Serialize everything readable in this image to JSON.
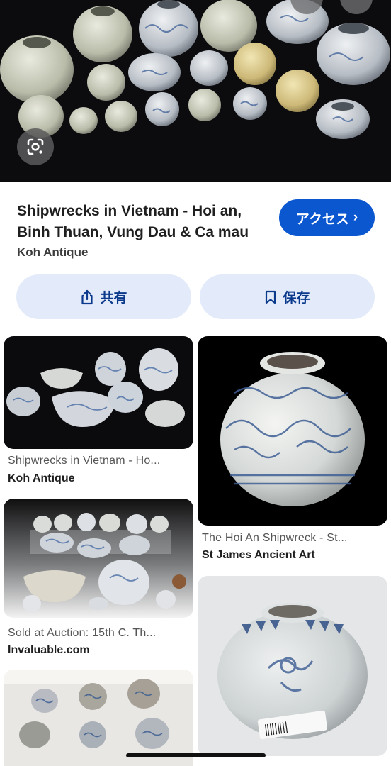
{
  "hero": {
    "lens_icon": "google-lens-icon"
  },
  "result": {
    "title": "Shipwrecks in Vietnam - Hoi an, Binh Thuan, Vung Dau & Ca mau",
    "source": "Koh Antique",
    "visit_label": "アクセス",
    "visit_chevron": "›",
    "share_label": "共有",
    "save_label": "保存",
    "share_icon": "share-icon",
    "save_icon": "bookmark-icon"
  },
  "related": [
    {
      "title": "Shipwrecks in Vietnam - Ho...",
      "source": "Koh Antique"
    },
    {
      "title": "The Hoi An Shipwreck - St...",
      "source": "St James Ancient Art"
    },
    {
      "title": "Sold at Auction: 15th C. Th...",
      "source": "Invaluable.com"
    },
    {
      "title": "",
      "source": ""
    }
  ],
  "colors": {
    "accent": "#0b57d0",
    "pill_bg": "#e3ebfa",
    "pill_text": "#0b3a8c"
  }
}
